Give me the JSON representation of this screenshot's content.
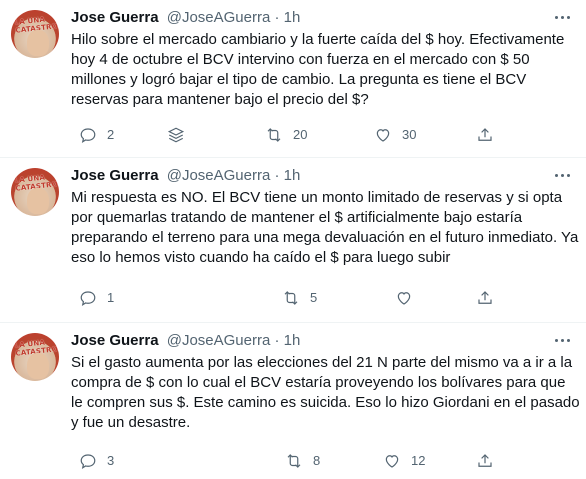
{
  "tweets": [
    {
      "name": "Jose Guerra",
      "handle": "@JoseAGuerra",
      "dot": "·",
      "time": "1h",
      "text": "Hilo sobre el mercado cambiario y la fuerte caída del $ hoy. Efectivamente hoy 4 de octubre el BCV intervino con fuerza en el mercado con $ 50 millones y logró bajar el tipo de cambio. La pregunta es  tiene el BCV reservas para mantener bajo el precio del $?",
      "replies": "2",
      "retweets": "20",
      "likes": "30"
    },
    {
      "name": "Jose Guerra",
      "handle": "@JoseAGuerra",
      "dot": "·",
      "time": "1h",
      "text": "Mi respuesta es NO. El BCV tiene un monto limitado de reservas y si opta por quemarlas tratando de mantener el $ artificialmente bajo estaría preparando el terreno para una mega devaluación en el futuro inmediato. Ya eso lo hemos visto cuando ha caído el $ para luego subir",
      "replies": "1",
      "retweets": "5",
      "likes": ""
    },
    {
      "name": "Jose Guerra",
      "handle": "@JoseAGuerra",
      "dot": "·",
      "time": "1h",
      "text": "Si el gasto aumenta por las elecciones del 21 N parte del mismo va a ir a la compra de $ con lo cual el BCV estaría proveyendo los bolívares para que le compren sus $. Este camino es suicida. Eso lo hizo Giordani en el pasado y fue un desastre.",
      "replies": "3",
      "retweets": "8",
      "likes": "12"
    }
  ],
  "avatar_text": "LA UNA CATASTROFE"
}
